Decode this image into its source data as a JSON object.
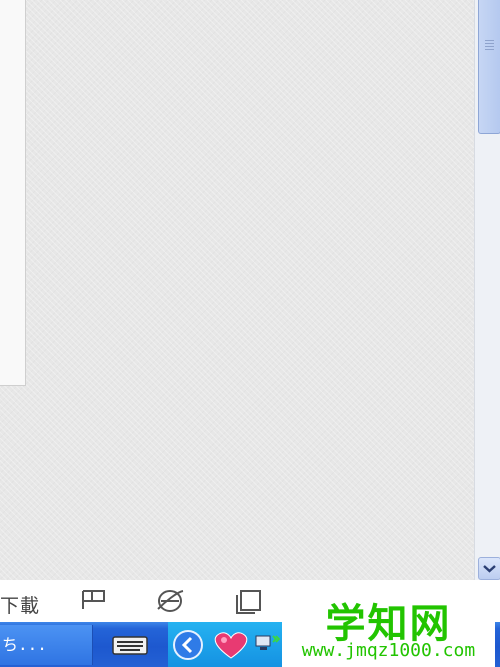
{
  "toolbar": {
    "download_label": "下載",
    "icons": [
      "flag-icon",
      "internet-explorer-icon",
      "window-restore-icon"
    ]
  },
  "taskbar": {
    "task_label": "ち...",
    "tray_icons": [
      "keyboard-icon",
      "back-arrow-icon",
      "heart-icon",
      "network-icon"
    ]
  },
  "watermark": {
    "title": "学知网",
    "url": "www.jmqz1000.com"
  },
  "colors": {
    "taskbar": "#2464d8",
    "tray": "#1592e2",
    "watermark_green": "#22c400",
    "scroll_thumb": "#b5c9ef"
  }
}
